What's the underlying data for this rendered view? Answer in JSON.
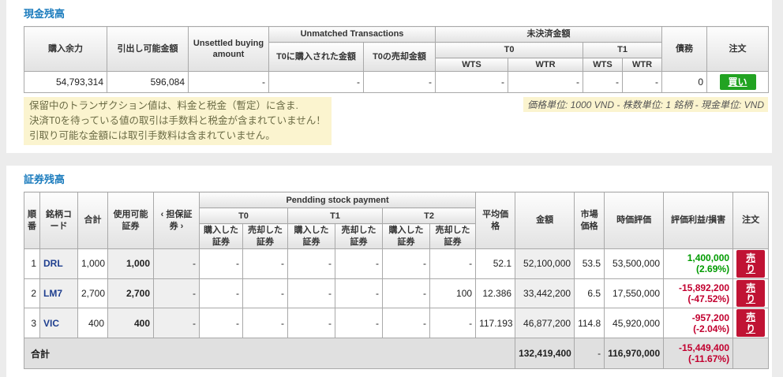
{
  "cash": {
    "title": "現金残高",
    "headers": {
      "buying_power": "購入余力",
      "withdrawable": "引出し可能金額",
      "unsettled_buying": "Unsettled buying amount",
      "unmatched_group": "Unmatched Transactions",
      "unmatched_bought_t0": "T0に購入された金額",
      "unmatched_sold_t0": "T0の売却金額",
      "pending_group": "未決済金額",
      "t0": "T0",
      "t1": "T1",
      "wts": "WTS",
      "wtr": "WTR",
      "debt": "債務",
      "order": "注文"
    },
    "row": {
      "buying_power": "54,793,314",
      "withdrawable": "596,084",
      "unsettled_buying": "-",
      "unmatched_bought_t0": "-",
      "unmatched_sold_t0": "-",
      "t0_wts": "-",
      "t0_wtr": "-",
      "t1_wts": "-",
      "t1_wtr": "-",
      "debt": "0",
      "order_label": "買い"
    },
    "notes": [
      "保留中のトランザクション値は、料金と税金（暫定）に含ま.",
      "決済T0を待っている値の取引は手数料と税金が含まれていません！",
      "引取り可能な金額には取引手数料は含まれていません。"
    ],
    "units_note": "価格単位: 1000 VND - 株数単位: 1 銘柄 - 現金単位: VND"
  },
  "securities": {
    "title": "証券残高",
    "headers": {
      "no": "順番",
      "code": "銘柄コード",
      "total": "合計",
      "available": "使用可能証券",
      "collateral": "‹ 担保証券 ›",
      "pending_stock_group": "Pendding stock payment",
      "t0": "T0",
      "t1": "T1",
      "t2": "T2",
      "bought": "購入した証券",
      "sold": "売却した証券",
      "avg_price": "平均価格",
      "amount": "金額",
      "market_price": "市場価格",
      "market_value": "時価評価",
      "pl": "評価利益/損害",
      "order": "注文"
    },
    "rows": [
      {
        "no": "1",
        "code": "DRL",
        "total": "1,000",
        "available": "1,000",
        "collateral": "-",
        "t0_bought": "-",
        "t0_sold": "-",
        "t1_bought": "-",
        "t1_sold": "-",
        "t2_bought": "-",
        "t2_sold": "-",
        "avg_price": "52.1",
        "amount": "52,100,000",
        "market_price": "53.5",
        "market_value": "53,500,000",
        "pl": "1,400,000",
        "pl_pct": "(2.69%)",
        "order_label": "売り"
      },
      {
        "no": "2",
        "code": "LM7",
        "total": "2,700",
        "available": "2,700",
        "collateral": "-",
        "t0_bought": "-",
        "t0_sold": "-",
        "t1_bought": "-",
        "t1_sold": "-",
        "t2_bought": "-",
        "t2_sold": "100",
        "avg_price": "12.386",
        "amount": "33,442,200",
        "market_price": "6.5",
        "market_value": "17,550,000",
        "pl": "-15,892,200",
        "pl_pct": "(-47.52%)",
        "order_label": "売り"
      },
      {
        "no": "3",
        "code": "VIC",
        "total": "400",
        "available": "400",
        "collateral": "-",
        "t0_bought": "-",
        "t0_sold": "-",
        "t1_bought": "-",
        "t1_sold": "-",
        "t2_bought": "-",
        "t2_sold": "-",
        "avg_price": "117.193",
        "amount": "46,877,200",
        "market_price": "114.8",
        "market_value": "45,920,000",
        "pl": "-957,200",
        "pl_pct": "(-2.04%)",
        "order_label": "売り"
      }
    ],
    "total_row": {
      "label": "合計",
      "amount": "132,419,400",
      "market_price": "-",
      "market_value": "116,970,000",
      "pl": "-15,449,400",
      "pl_pct": "(-11.67%)"
    }
  },
  "colors": {
    "title_blue": "#1a7bbd",
    "buy_green": "#22a322",
    "sell_red": "#c01334",
    "profit_green": "#009b00",
    "loss_red": "#c2002f",
    "note_bg": "#fbf4cf",
    "header_bg": "#e2e2e2"
  }
}
